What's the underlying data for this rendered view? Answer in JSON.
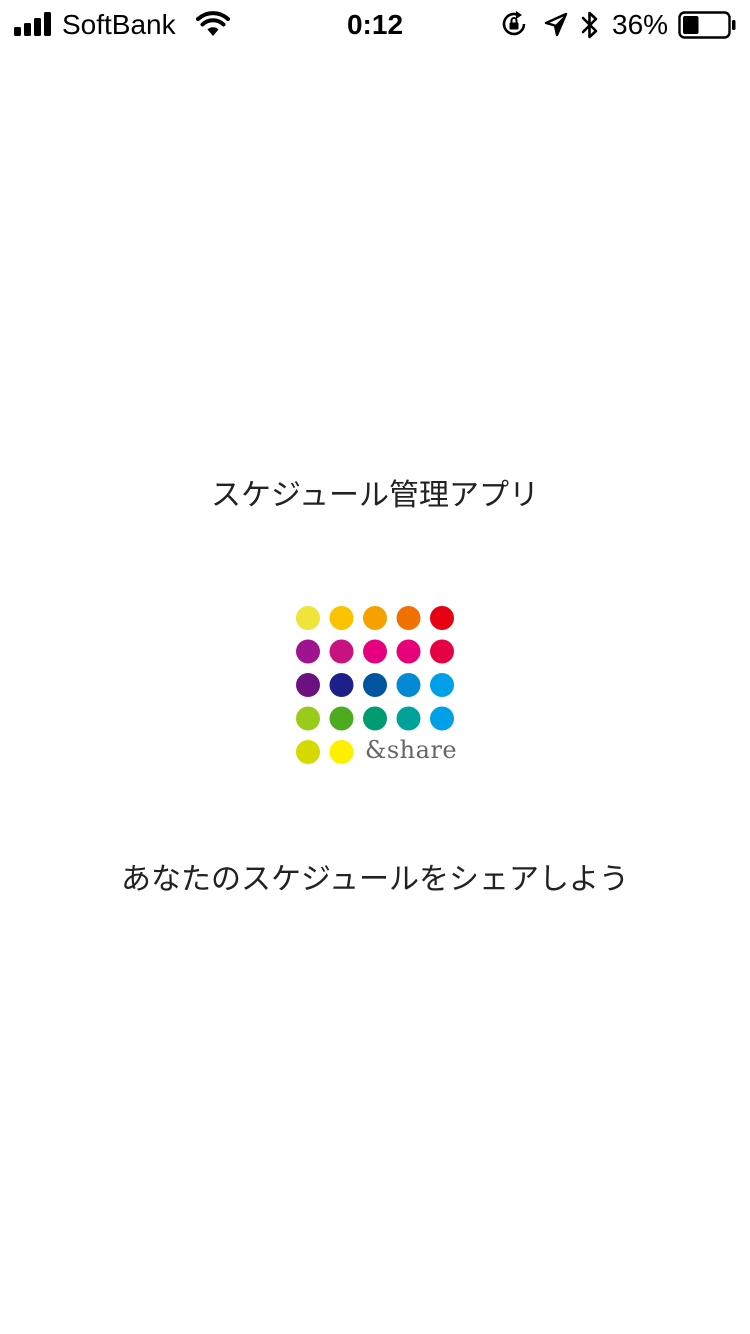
{
  "status_bar": {
    "carrier": "SoftBank",
    "time": "0:12",
    "battery_percent": "36%",
    "battery_level": 0.36,
    "icons": [
      "signal-icon",
      "wifi-icon",
      "rotation-lock-icon",
      "location-icon",
      "bluetooth-icon",
      "battery-icon"
    ]
  },
  "main": {
    "title": "スケジュール管理アプリ",
    "logo_text": "&share",
    "tagline": "あなたのスケジュールをシェアしよう"
  },
  "logo_colors": [
    [
      "#EEE43A",
      "#F9C300",
      "#F5A100",
      "#F07000",
      "#E60012"
    ],
    [
      "#A0138E",
      "#C8127F",
      "#E4007F",
      "#E8007A",
      "#E60044"
    ],
    [
      "#6B1180",
      "#1D2088",
      "#00569E",
      "#0489D4",
      "#00A0E9"
    ],
    [
      "#9ACA1A",
      "#4CAB1E",
      "#009C71",
      "#00A29A",
      "#00A0E9"
    ],
    [
      "#D4DA00",
      "#FFF000"
    ]
  ]
}
